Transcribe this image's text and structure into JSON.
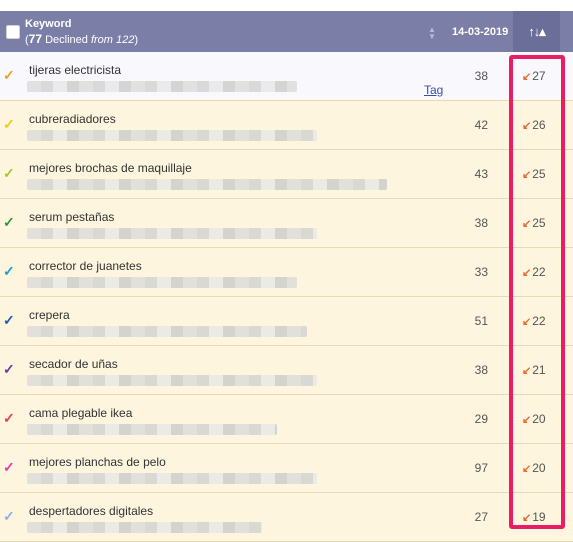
{
  "header": {
    "keyword_label": "Keyword",
    "declined_open": "(",
    "declined_count": "77",
    "declined_word": " Declined ",
    "from_text": "from 122",
    "declined_close": ")",
    "date": "14-03-2019",
    "change_icon": "sort-change-icon",
    "sort_icon": "sort-icon"
  },
  "rows": [
    {
      "keyword": "tijeras electricista",
      "position": "38",
      "change": "27",
      "check_color": "#f0a020",
      "tag": "Tag"
    },
    {
      "keyword": "cubreradiadores",
      "position": "42",
      "change": "26",
      "check_color": "#f0c820"
    },
    {
      "keyword": "mejores brochas de maquillaje",
      "position": "43",
      "change": "25",
      "check_color": "#9ccc30"
    },
    {
      "keyword": "serum pestañas",
      "position": "38",
      "change": "25",
      "check_color": "#2e9a3a"
    },
    {
      "keyword": "corrector de juanetes",
      "position": "33",
      "change": "22",
      "check_color": "#1aa0c8"
    },
    {
      "keyword": "crepera",
      "position": "51",
      "change": "22",
      "check_color": "#1c5fb0"
    },
    {
      "keyword": "secador de uñas",
      "position": "38",
      "change": "21",
      "check_color": "#6a3aa8"
    },
    {
      "keyword": "cama plegable ikea",
      "position": "29",
      "change": "20",
      "check_color": "#e83a5a"
    },
    {
      "keyword": "mejores planchas de pelo",
      "position": "97",
      "change": "20",
      "check_color": "#e83aa8"
    },
    {
      "keyword": "despertadores digitales",
      "position": "27",
      "change": "19",
      "check_color": "#8ab0e8"
    }
  ],
  "colors": {
    "header_bg": "#7b7fa8",
    "row_bg": "#fdf5de",
    "highlight": "#e81d62",
    "decline_arrow": "#e8692e"
  }
}
